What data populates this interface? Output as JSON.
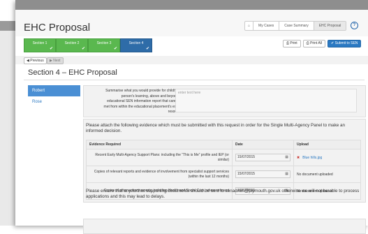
{
  "page": {
    "title": "EHC Proposal"
  },
  "breadcrumb": {
    "items": [
      "My Cases",
      "Case Summary",
      "EHC Proposal"
    ],
    "home_icon": "home-icon",
    "help_icon": "help-icon"
  },
  "sections": [
    {
      "label": "Section 1",
      "complete": true
    },
    {
      "label": "Section 2",
      "complete": true
    },
    {
      "label": "Section 3",
      "complete": true
    },
    {
      "label": "Section 4",
      "complete": true,
      "current": true
    }
  ],
  "actions": {
    "print": "Print",
    "print_all": "Print All",
    "submit": "Submit to SEN"
  },
  "nav": {
    "previous": "Previous",
    "next": "Next"
  },
  "section_heading": "Section 4 – EHC Proposal",
  "people": [
    {
      "name": "Robert",
      "active": true
    },
    {
      "name": "Rose",
      "active": false
    }
  ],
  "question": {
    "label": "Summarise what you would provide for child/young person's learning, above and beyond the educational SEN information report that cannot be met from within the educational placement's existing resources.",
    "placeholder": "enter text here"
  },
  "evidence": {
    "intro": "Please attach the following evidence which must be submitted with this request in order for the Single Multi-Agency Panel to make an informed decision.",
    "headers": [
      "Evidence Required",
      "Date",
      "Upload"
    ],
    "rows": [
      {
        "requirement": "Recent Early Multi-Agency Support Plans: including the “This is Me” profile and IEP (or similar)",
        "date": "15/07/2015",
        "upload": "Blue hills.jpg",
        "has_file": true
      },
      {
        "requirement": "Copies of relevant reports and evidence of involvement from specialist support services (within the last 12 months)",
        "date": "15/07/2015",
        "upload": "No document uploaded",
        "has_file": false
      },
      {
        "requirement": "Copies of other agency reports, including Health and Social Care, where relevant",
        "date": "15/07/2015",
        "upload": "No document uploaded",
        "has_file": false
      }
    ],
    "footer": "Please ensure that any further supporting documents should be sent to senadmin@plymouth.gov.uk otherwise we will not be able to process applications and this may lead to delays."
  },
  "colors": {
    "complete": "#5ab84f",
    "current": "#2e6ca8",
    "primary": "#2b79c2",
    "link": "#2b79c2"
  }
}
